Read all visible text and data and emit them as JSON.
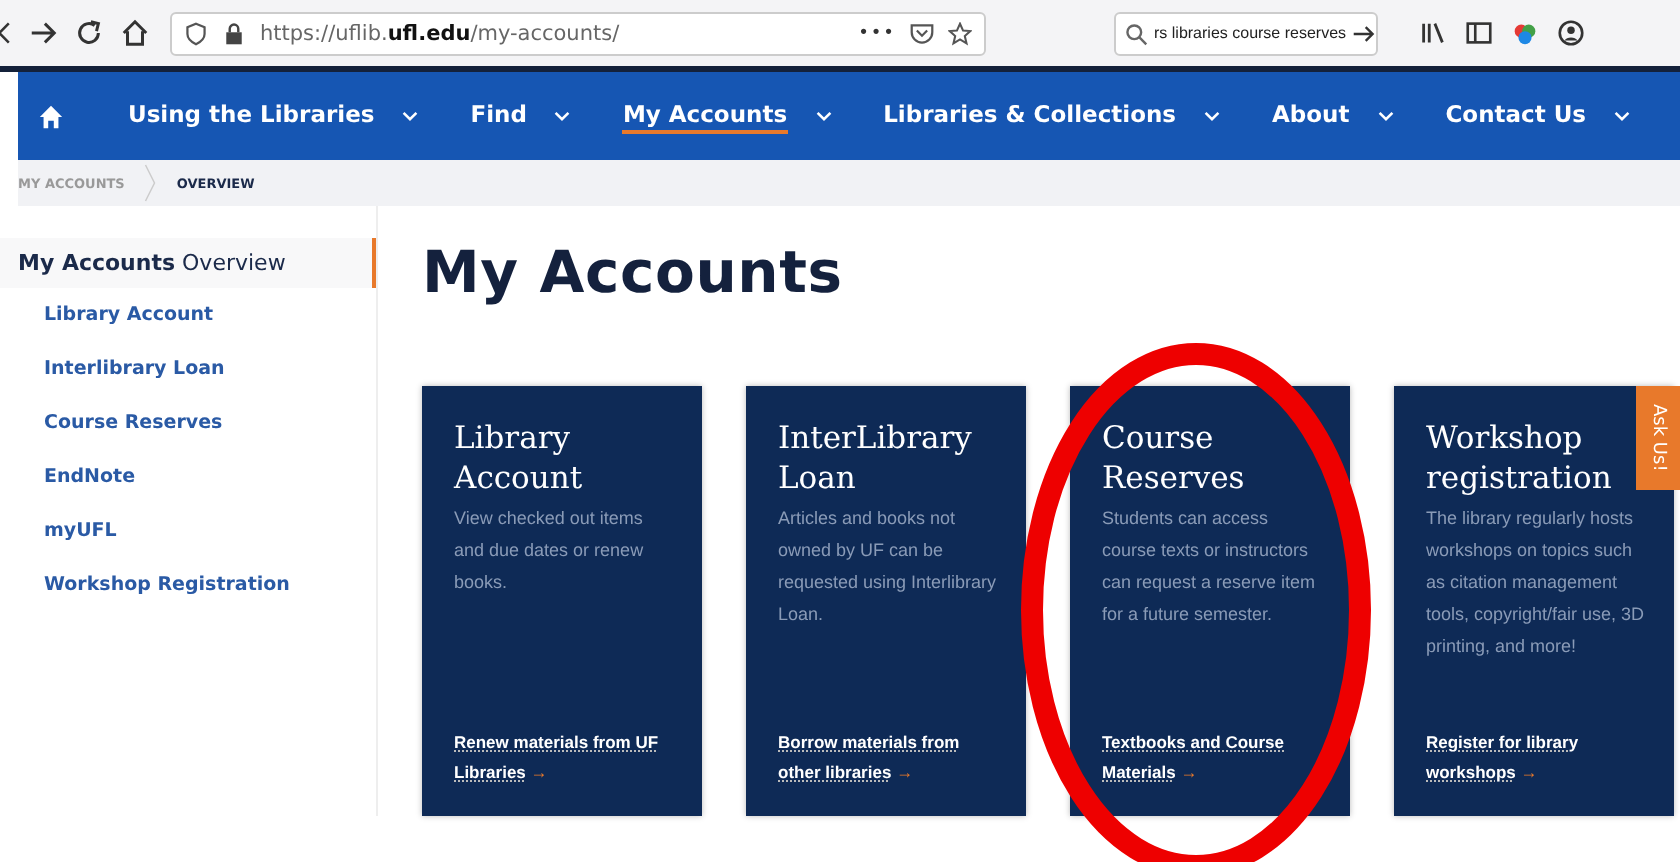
{
  "browser": {
    "url": "https://uflib.**ufl.edu**/my-accounts/",
    "page_actions": "•••",
    "search": "rs libraries course reserves"
  },
  "nav": {
    "items": [
      {
        "label": "Using the Libraries",
        "selected": false
      },
      {
        "label": "Find",
        "selected": false
      },
      {
        "label": "My Accounts",
        "selected": true
      },
      {
        "label": "Libraries & Collections",
        "selected": false
      },
      {
        "label": "About",
        "selected": false
      },
      {
        "label": "Contact Us",
        "selected": false
      }
    ]
  },
  "breadcrumb": [
    "MY ACCOUNTS",
    "OVERVIEW"
  ],
  "sidebar": {
    "heading": "**My Accounts** Overview",
    "items": [
      "Library Account",
      "Interlibrary Loan",
      "Course Reserves",
      "EndNote",
      "myUFL",
      "Workshop Registration"
    ]
  },
  "page_title": "My Accounts",
  "cards": [
    {
      "title": "Library Account",
      "text": "View checked out items and due dates or renew books.",
      "link": "Renew materials from UF Libraries",
      "arrow": "→"
    },
    {
      "title": "InterLibrary Loan",
      "text": "Articles and books not owned by UF can be requested using Interlibrary Loan.",
      "link": "Borrow materials from other libraries",
      "arrow": "→"
    },
    {
      "title": "Course Reserves",
      "text": "Students can access course texts or instructors can request a reserve item for a future semester.",
      "link": "Textbooks and Course Materials",
      "arrow": "→"
    },
    {
      "title": "Workshop registration",
      "text": "The library regularly hosts workshops on topics such as citation management tools, copyright/fair use, 3D printing, and more!",
      "link": "Register for library workshops",
      "arrow": "→"
    }
  ],
  "ask_tab": "Ask Us!",
  "annotation": {
    "kind": "ellipse",
    "color": "#ee0000"
  }
}
